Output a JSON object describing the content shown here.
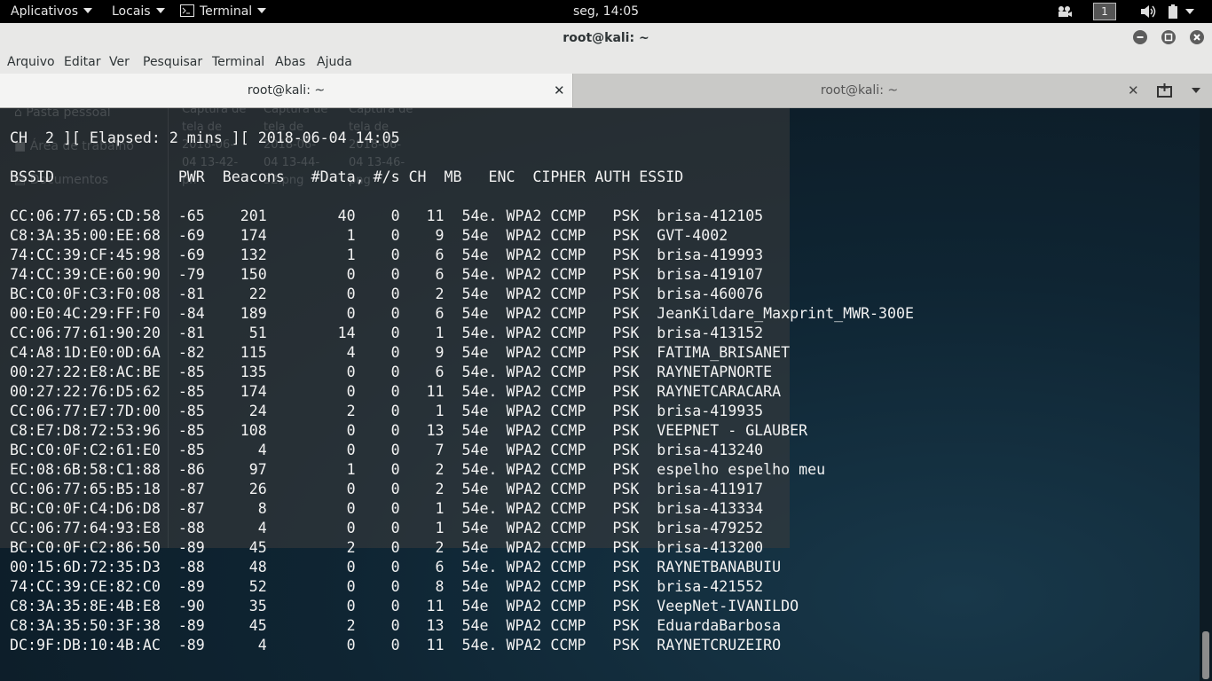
{
  "topbar": {
    "apps_label": "Aplicativos",
    "places_label": "Locais",
    "terminal_label": "Terminal",
    "clock": "seg, 14:05",
    "workspace": "1"
  },
  "window": {
    "title": "root@kali: ~",
    "menu": [
      "Arquivo",
      "Editar",
      "Ver",
      "Pesquisar",
      "Terminal",
      "Abas",
      "Ajuda"
    ],
    "tabs": [
      {
        "title": "root@kali: ~",
        "active": true
      },
      {
        "title": "root@kali: ~",
        "active": false
      }
    ]
  },
  "behind_window": {
    "sidebar": [
      "Pasta pessoal",
      "Área de trabalho",
      "Documentos"
    ],
    "files": [
      [
        "Captura de",
        "tela de",
        "2018-06-",
        "04 13-42-",
        "pn"
      ],
      [
        "Captura de",
        "tela de",
        "2018-06-",
        "04 13-44-",
        "32.png"
      ],
      [
        "Captura de",
        "tela de",
        "2018-06-",
        "04 13-46-",
        "png"
      ]
    ]
  },
  "terminal": {
    "status_line": "CH  2 ][ Elapsed: 2 mins ][ 2018-06-04 14:05",
    "headers": [
      "BSSID",
      "PWR",
      "Beacons",
      "#Data,",
      "#/s",
      "CH",
      "MB",
      "ENC",
      "CIPHER",
      "AUTH",
      "ESSID"
    ],
    "rows": [
      [
        "CC:06:77:65:CD:58",
        "-65",
        "201",
        "40",
        "0",
        "11",
        "54e.",
        "WPA2",
        "CCMP",
        "PSK",
        "brisa-412105"
      ],
      [
        "C8:3A:35:00:EE:68",
        "-69",
        "174",
        "1",
        "0",
        "9",
        "54e",
        "WPA2",
        "CCMP",
        "PSK",
        "GVT-4002"
      ],
      [
        "74:CC:39:CF:45:98",
        "-69",
        "132",
        "1",
        "0",
        "6",
        "54e",
        "WPA2",
        "CCMP",
        "PSK",
        "brisa-419993"
      ],
      [
        "74:CC:39:CE:60:90",
        "-79",
        "150",
        "0",
        "0",
        "6",
        "54e.",
        "WPA2",
        "CCMP",
        "PSK",
        "brisa-419107"
      ],
      [
        "BC:C0:0F:C3:F0:08",
        "-81",
        "22",
        "0",
        "0",
        "2",
        "54e",
        "WPA2",
        "CCMP",
        "PSK",
        "brisa-460076"
      ],
      [
        "00:E0:4C:29:FF:F0",
        "-84",
        "189",
        "0",
        "0",
        "6",
        "54e",
        "WPA2",
        "CCMP",
        "PSK",
        "JeanKildare_Maxprint_MWR-300E"
      ],
      [
        "CC:06:77:61:90:20",
        "-81",
        "51",
        "14",
        "0",
        "1",
        "54e.",
        "WPA2",
        "CCMP",
        "PSK",
        "brisa-413152"
      ],
      [
        "C4:A8:1D:E0:0D:6A",
        "-82",
        "115",
        "4",
        "0",
        "9",
        "54e",
        "WPA2",
        "CCMP",
        "PSK",
        "FATIMA_BRISANET"
      ],
      [
        "00:27:22:E8:AC:BE",
        "-85",
        "135",
        "0",
        "0",
        "6",
        "54e.",
        "WPA2",
        "CCMP",
        "PSK",
        "RAYNETAPNORTE"
      ],
      [
        "00:27:22:76:D5:62",
        "-85",
        "174",
        "0",
        "0",
        "11",
        "54e.",
        "WPA2",
        "CCMP",
        "PSK",
        "RAYNETCARACARA"
      ],
      [
        "CC:06:77:E7:7D:00",
        "-85",
        "24",
        "2",
        "0",
        "1",
        "54e",
        "WPA2",
        "CCMP",
        "PSK",
        "brisa-419935"
      ],
      [
        "C8:E7:D8:72:53:96",
        "-85",
        "108",
        "0",
        "0",
        "13",
        "54e",
        "WPA2",
        "CCMP",
        "PSK",
        "VEEPNET - GLAUBER"
      ],
      [
        "BC:C0:0F:C2:61:E0",
        "-85",
        "4",
        "0",
        "0",
        "7",
        "54e",
        "WPA2",
        "CCMP",
        "PSK",
        "brisa-413240"
      ],
      [
        "EC:08:6B:58:C1:88",
        "-86",
        "97",
        "1",
        "0",
        "2",
        "54e.",
        "WPA2",
        "CCMP",
        "PSK",
        "espelho espelho meu"
      ],
      [
        "CC:06:77:65:B5:18",
        "-87",
        "26",
        "0",
        "0",
        "2",
        "54e",
        "WPA2",
        "CCMP",
        "PSK",
        "brisa-411917"
      ],
      [
        "BC:C0:0F:C4:D6:D8",
        "-87",
        "8",
        "0",
        "0",
        "1",
        "54e.",
        "WPA2",
        "CCMP",
        "PSK",
        "brisa-413334"
      ],
      [
        "CC:06:77:64:93:E8",
        "-88",
        "4",
        "0",
        "0",
        "1",
        "54e",
        "WPA2",
        "CCMP",
        "PSK",
        "brisa-479252"
      ],
      [
        "BC:C0:0F:C2:86:50",
        "-89",
        "45",
        "2",
        "0",
        "2",
        "54e",
        "WPA2",
        "CCMP",
        "PSK",
        "brisa-413200"
      ],
      [
        "00:15:6D:72:35:D3",
        "-88",
        "48",
        "0",
        "0",
        "6",
        "54e.",
        "WPA2",
        "CCMP",
        "PSK",
        "RAYNETBANABUIU"
      ],
      [
        "74:CC:39:CE:82:C0",
        "-89",
        "52",
        "0",
        "0",
        "8",
        "54e",
        "WPA2",
        "CCMP",
        "PSK",
        "brisa-421552"
      ],
      [
        "C8:3A:35:8E:4B:E8",
        "-90",
        "35",
        "0",
        "0",
        "11",
        "54e",
        "WPA2",
        "CCMP",
        "PSK",
        "VeepNet-IVANILDO"
      ],
      [
        "C8:3A:35:50:3F:38",
        "-89",
        "45",
        "2",
        "0",
        "13",
        "54e",
        "WPA2",
        "CCMP",
        "PSK",
        "EduardaBarbosa"
      ],
      [
        "DC:9F:DB:10:4B:AC",
        "-89",
        "4",
        "0",
        "0",
        "11",
        "54e.",
        "WPA2",
        "CCMP",
        "PSK",
        "RAYNETCRUZEIRO"
      ]
    ]
  },
  "colors": {
    "terminal_text": "#f2f2f2",
    "topbar_bg": "#000000",
    "titlebar_bg": "#e8e8e7"
  }
}
